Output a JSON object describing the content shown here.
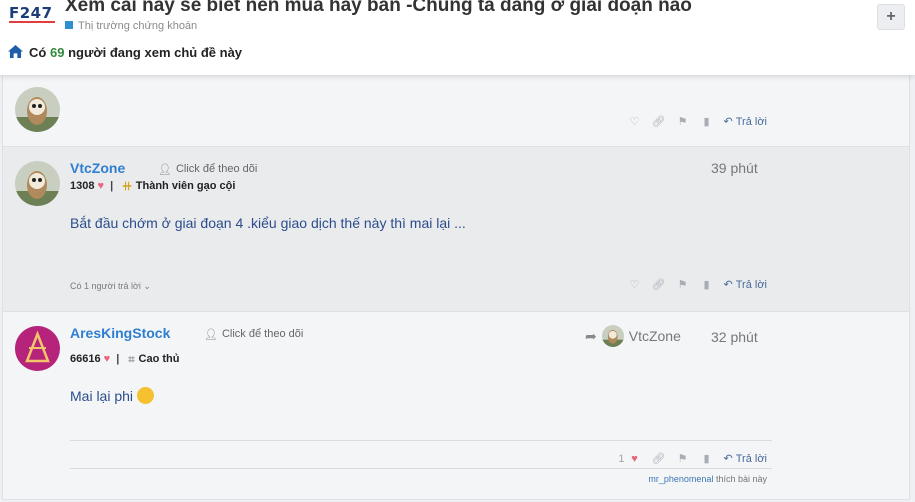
{
  "header": {
    "logo": "F247",
    "title": "Xem cái này sẽ biết nên mua hay bán -Chúng ta đang ở giai đoạn nào",
    "category": "Thị trường chứng khoán",
    "plus_label": "+",
    "viewers_prefix": "Có",
    "viewers_count": "69",
    "viewers_suffix": "người đang xem chủ đề này"
  },
  "actions": {
    "reply_label": "Trả lời"
  },
  "posts": [
    {
      "id": "top"
    },
    {
      "username": "VtcZone",
      "follow_label": "Click để theo dõi",
      "points": "1308",
      "rank": "Thành viên gạo cội",
      "time": "39 phút",
      "body": "Bắt đầu chớm ở giai đoạn 4 .kiểu giao dịch thế này thì mai lại ...",
      "replies": "Có 1 người trả lời"
    },
    {
      "username": "AresKingStock",
      "follow_label": "Click để theo dõi",
      "points": "66616",
      "rank": "Cao thủ",
      "time": "32 phút",
      "quote_user": "VtcZone",
      "body": "Mai lại phi",
      "like_count": "1",
      "liked_by": "mr_phenomenal",
      "liked_suffix": "thích bài này"
    }
  ],
  "colors": {
    "accent": "#2f7fd0",
    "heart": "#e8667b",
    "viewer_count": "#2f8a3b"
  },
  "icons": [
    "home-icon",
    "plus-icon",
    "heart-icon",
    "link-icon",
    "flag-icon",
    "bookmark-icon",
    "reply-icon",
    "follow-user-icon",
    "rank-medal-icon",
    "rank-chart-icon",
    "share-arrow-icon",
    "chevron-down-icon",
    "emoji-icon"
  ]
}
